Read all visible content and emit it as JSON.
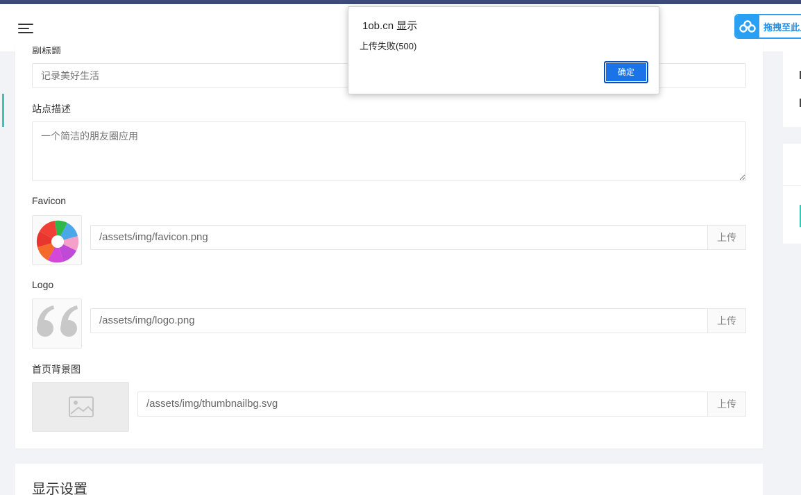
{
  "dialog": {
    "title": "1ob.cn 显示",
    "message": "上传失败(500)",
    "ok_label": "确定"
  },
  "toolbar": {
    "drag_label": "拖拽至此上"
  },
  "form": {
    "subtitle_label": "副标题",
    "subtitle_placeholder": "记录美好生活",
    "description_label": "站点描述",
    "description_placeholder": "一个简洁的朋友圈应用",
    "favicon_label": "Favicon",
    "favicon_path": "/assets/img/favicon.png",
    "favicon_upload": "上传",
    "logo_label": "Logo",
    "logo_path": "/assets/img/logo.png",
    "logo_upload": "上传",
    "bg_label": "首页背景图",
    "bg_path": "/assets/img/thumbnailbg.svg",
    "bg_upload": "上传"
  },
  "section2": {
    "title": "显示设置"
  },
  "colors": {
    "accent": "#39c5b5",
    "dialog_button": "#1a73e8",
    "drag_button": "#2aa0f5"
  }
}
